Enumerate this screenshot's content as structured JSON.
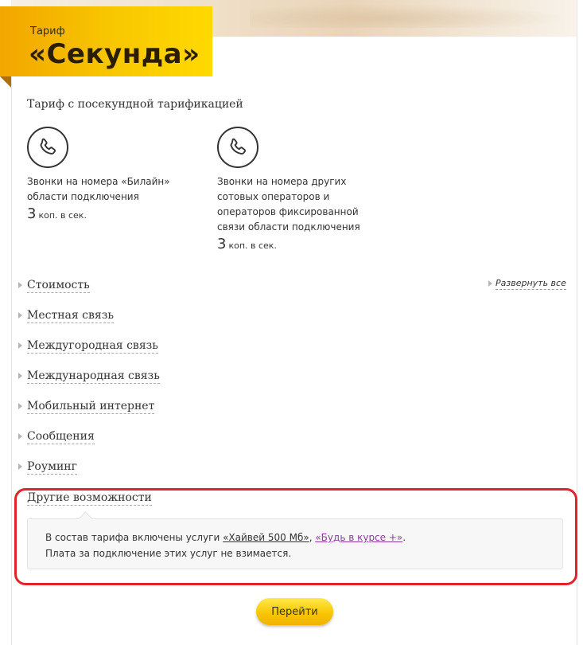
{
  "banner": {
    "small": "Тариф",
    "title": "«Секунда»"
  },
  "subtitle": "Тариф с посекундной тарификацией",
  "call_types": [
    {
      "lines": [
        "Звонки на номера «Билайн»",
        "области подключения"
      ],
      "price_value": "3",
      "price_unit": "коп. в сек.",
      "icon": "phone-icon"
    },
    {
      "lines": [
        "Звонки на номера других",
        "сотовых операторов и",
        "операторов фиксированной",
        "связи области подключения"
      ],
      "price_value": "3",
      "price_unit": "коп. в сек.",
      "icon": "phone-icon"
    }
  ],
  "expand_all": "Развернуть все",
  "sections": [
    "Стоимость",
    "Местная связь",
    "Междугородная связь",
    "Международная связь",
    "Мобильный интернет",
    "Сообщения",
    "Роуминг"
  ],
  "other": {
    "title": "Другие возможности",
    "text_prefix": "В состав тарифа включены услуги ",
    "link1": "«Хайвей 500 Мб»",
    "separator": ", ",
    "link2": "«Будь в курсе +»",
    "text_suffix": ".",
    "line2": "Плата за подключение этих услуг не взимается."
  },
  "go_button": "Перейти",
  "colors": {
    "banner": "#f8c800",
    "highlight": "#e2232a",
    "visited_link": "#8a3e9a"
  }
}
